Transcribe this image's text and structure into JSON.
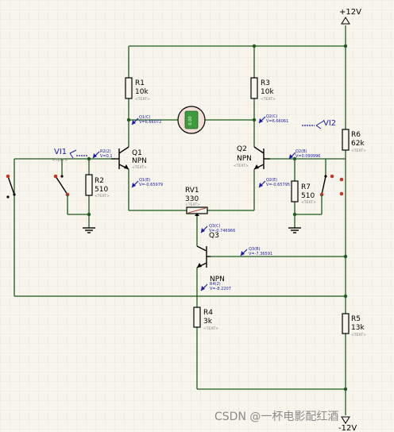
{
  "rails": {
    "top": "+12V",
    "bottom": "-12V"
  },
  "terminals": {
    "left": "VI1",
    "right": "VI2"
  },
  "components": {
    "R1": {
      "name": "R1",
      "value": "10k",
      "text": "<TEXT>"
    },
    "R3": {
      "name": "R3",
      "value": "10k",
      "text": "<TEXT>"
    },
    "R2": {
      "name": "R2",
      "value": "510",
      "text": "<TEXT>"
    },
    "R7": {
      "name": "R7",
      "value": "510",
      "text": "<TEXT>"
    },
    "R6": {
      "name": "R6",
      "value": "62k",
      "text": "<TEXT>"
    },
    "R4": {
      "name": "R4",
      "value": "3k",
      "text": "<TEXT>"
    },
    "R5": {
      "name": "R5",
      "value": "13k",
      "text": "<TEXT>"
    },
    "RV1": {
      "name": "RV1",
      "value": "330",
      "text": "<TEXT>"
    },
    "Q1": {
      "name": "Q1",
      "type": "NPN",
      "text": "<TEXT>"
    },
    "Q2": {
      "name": "Q2",
      "type": "NPN",
      "text": "<TEXT>"
    },
    "Q3": {
      "name": "Q3",
      "type": "NPN",
      "text": "<TEXT>"
    }
  },
  "probes": {
    "q1c": {
      "name": "Q1(C)",
      "value": "V=6.66072"
    },
    "q1b": {
      "name": "R2(2)",
      "value": "V=0.1"
    },
    "q1e": {
      "name": "Q1(E)",
      "value": "V=-0.65979"
    },
    "q2c": {
      "name": "Q2(C)",
      "value": "V=6.66061"
    },
    "q2b": {
      "name": "Q2(B)",
      "value": "V=0.099996"
    },
    "q2e": {
      "name": "Q2(E)",
      "value": "V=-0.65795"
    },
    "q3c": {
      "name": "Q3(C)",
      "value": "V=-0.746966"
    },
    "q3b": {
      "name": "Q3(B)",
      "value": "V=-7.36591"
    },
    "q3e": {
      "name": "R4(2)",
      "value": "V=-8.2207"
    },
    "vi1": {
      "name": "",
      "value": "<TEXT>"
    }
  },
  "meter": {
    "display": "0.00"
  },
  "watermark": "CSDN @一杯电影配红酒",
  "colors": {
    "wire": "#1c5c1c",
    "grid": "#dcdbd0",
    "probe": "#1a1aa8",
    "switch_dot": "#c0392b"
  }
}
